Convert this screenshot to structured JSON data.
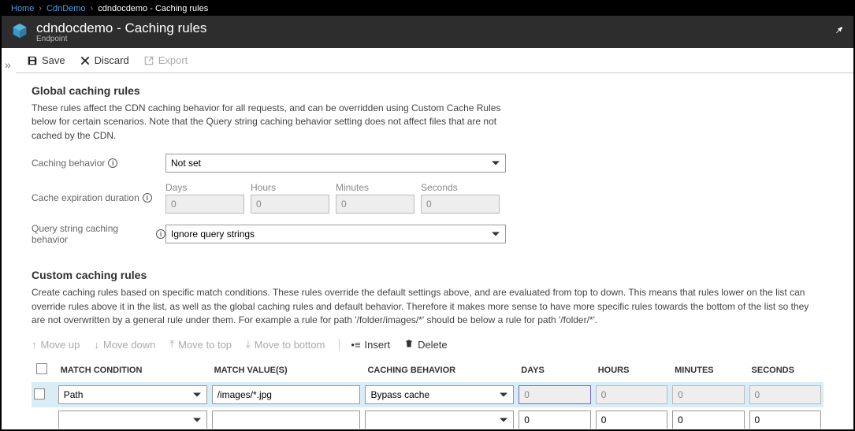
{
  "breadcrumb": {
    "home": "Home",
    "demo": "CdnDemo",
    "current": "cdndocdemo - Caching rules"
  },
  "header": {
    "title": "cdndocdemo - Caching rules",
    "subtitle": "Endpoint"
  },
  "toolbar": {
    "save": "Save",
    "discard": "Discard",
    "export": "Export"
  },
  "global": {
    "heading": "Global caching rules",
    "desc": "These rules affect the CDN caching behavior for all requests, and can be overridden using Custom Cache Rules below for certain scenarios. Note that the Query string caching behavior setting does not affect files that are not cached by the CDN.",
    "caching_behavior_label": "Caching behavior",
    "caching_behavior_value": "Not set",
    "expiration_label": "Cache expiration duration",
    "days_label": "Days",
    "hours_label": "Hours",
    "minutes_label": "Minutes",
    "seconds_label": "Seconds",
    "days": "0",
    "hours": "0",
    "minutes": "0",
    "seconds": "0",
    "query_label": "Query string caching behavior",
    "query_value": "Ignore query strings"
  },
  "custom": {
    "heading": "Custom caching rules",
    "desc": "Create caching rules based on specific match conditions. These rules override the default settings above, and are evaluated from top to down. This means that rules lower on the list can override rules above it in the list, as well as the global caching rules and default behavior. Therefore it makes more sense to have more specific rules towards the bottom of the list so they are not overwritten by a general rule under them. For example a rule for path '/folder/images/*' should be below a rule for path '/folder/*'.",
    "move_up": "Move up",
    "move_down": "Move down",
    "move_top": "Move to top",
    "move_bottom": "Move to bottom",
    "insert": "Insert",
    "delete": "Delete",
    "col_cond": "MATCH CONDITION",
    "col_val": "MATCH VALUE(S)",
    "col_behav": "CACHING BEHAVIOR",
    "col_days": "DAYS",
    "col_hours": "HOURS",
    "col_minutes": "MINUTES",
    "col_seconds": "SECONDS",
    "rows": [
      {
        "cond": "Path",
        "val": "/images/*.jpg",
        "behav": "Bypass cache",
        "days": "0",
        "hours": "0",
        "minutes": "0",
        "seconds": "0",
        "selected": true,
        "disabled_time": true
      },
      {
        "cond": "",
        "val": "",
        "behav": "",
        "days": "0",
        "hours": "0",
        "minutes": "0",
        "seconds": "0",
        "selected": false,
        "disabled_time": false
      }
    ]
  }
}
